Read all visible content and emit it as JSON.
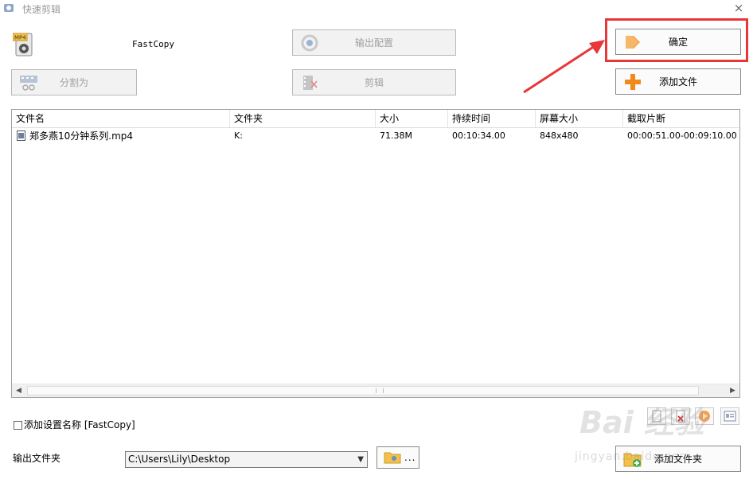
{
  "window": {
    "title": "快速剪辑"
  },
  "profile": {
    "name": "FastCopy"
  },
  "toolbar": {
    "output_config": "输出配置",
    "confirm": "确定",
    "split": "分割为",
    "cut": "剪辑",
    "add_file": "添加文件"
  },
  "table": {
    "columns": [
      "文件名",
      "文件夹",
      "大小",
      "持续时间",
      "屏幕大小",
      "截取片断"
    ],
    "rows": [
      {
        "name": "郑多燕10分钟系列.mp4",
        "folder": "K:",
        "size": "71.38M",
        "duration": "00:10:34.00",
        "screen": "848x480",
        "clip": "00:00:51.00-00:09:10.00"
      }
    ]
  },
  "options": {
    "add_setting_name": "添加设置名称 [FastCopy]"
  },
  "output": {
    "label": "输出文件夹",
    "path": "C:\\Users\\Lily\\Desktop",
    "browse_dots": "..."
  },
  "bottom": {
    "add_folder": "添加文件夹"
  },
  "watermark": {
    "brand": "Bai 经验",
    "url": "jingyan.baidu.com"
  },
  "colors": {
    "annotation_red": "#e8363a",
    "add_icon_orange": "#f08a1c"
  }
}
